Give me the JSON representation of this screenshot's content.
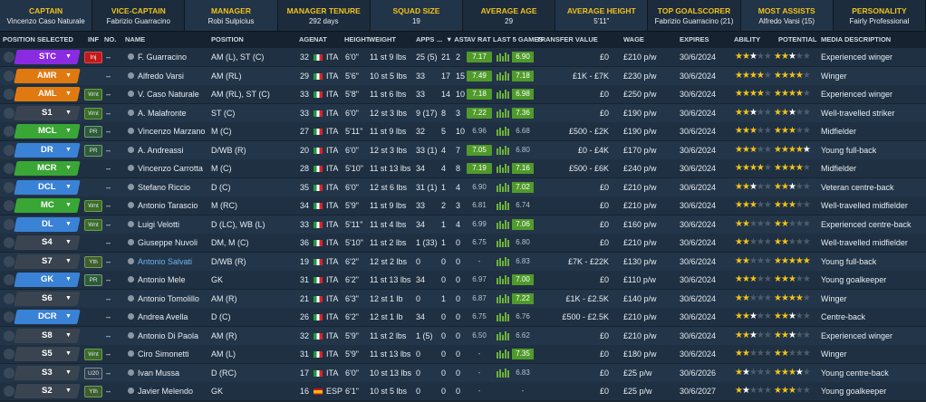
{
  "summary": [
    {
      "label": "CAPTAIN",
      "value": "Vincenzo Caso Naturale"
    },
    {
      "label": "VICE-CAPTAIN",
      "value": "Fabrizio Guarracino"
    },
    {
      "label": "MANAGER",
      "value": "Robi Sulpicius"
    },
    {
      "label": "MANAGER TENURE",
      "value": "292 days"
    },
    {
      "label": "SQUAD SIZE",
      "value": "19"
    },
    {
      "label": "AVERAGE AGE",
      "value": "29"
    },
    {
      "label": "AVERAGE HEIGHT",
      "value": "5'11\""
    },
    {
      "label": "TOP GOALSCORER",
      "value": "Fabrizio Guarracino (21)"
    },
    {
      "label": "MOST ASSISTS",
      "value": "Alfredo Varsi (15)"
    },
    {
      "label": "PERSONALITY",
      "value": "Fairly Professional"
    }
  ],
  "columns": {
    "position_selected": "POSITION SELECTED",
    "inf": "INF",
    "no": "NO.",
    "name": "NAME",
    "position": "POSITION",
    "age": "AGE",
    "nat": "NAT",
    "height": "HEIGHT",
    "weight": "WEIGHT",
    "apps": "APPS",
    "gls": "...",
    "ast": "▼ AST",
    "av_rat": "AV RAT",
    "last5": "LAST 5 GAMES",
    "transfer": "TRANSFER VALUE",
    "wage": "WAGE",
    "expires": "EXPIRES",
    "ability": "ABILITY",
    "potential": "POTENTIAL",
    "media": "MEDIA DESCRIPTION"
  },
  "colors": {
    "purple": "#8a2be2",
    "orange": "#e07a10",
    "green": "#3aa635",
    "blue": "#3a82d6",
    "dark": "#3a4450"
  },
  "players": [
    {
      "slot": "STC",
      "slot_color": "purple",
      "inf": "Inj",
      "no": "–",
      "name": "F. Guarracino",
      "position": "AM (L), ST (C)",
      "age": "32",
      "nat": "ITA",
      "height": "6'0\"",
      "weight": "11 st 9 lbs",
      "apps": "25 (5)",
      "gls": "21",
      "ast": "2",
      "avr": "7.17",
      "avr_hl": true,
      "l5": "6.90",
      "l5_hl": true,
      "transfer": "£0",
      "wage": "£210 p/w",
      "expires": "30/6/2024",
      "ability": 2.5,
      "potential": 2.5,
      "media": "Experienced winger"
    },
    {
      "slot": "AMR",
      "slot_color": "orange",
      "inf": "",
      "no": "–",
      "name": "Alfredo Varsi",
      "position": "AM (RL)",
      "age": "29",
      "nat": "ITA",
      "height": "5'6\"",
      "weight": "10 st 5 lbs",
      "apps": "33",
      "gls": "17",
      "ast": "15",
      "avr": "7.49",
      "avr_hl": true,
      "l5": "7.18",
      "l5_hl": true,
      "transfer": "£1K - £7K",
      "wage": "£230 p/w",
      "expires": "30/6/2024",
      "ability": 4,
      "potential": 4,
      "media": "Winger"
    },
    {
      "slot": "AML",
      "slot_color": "orange",
      "inf": "Wnt",
      "no": "–",
      "name": "V. Caso Naturale",
      "position": "AM (RL), ST (C)",
      "age": "33",
      "nat": "ITA",
      "height": "5'8\"",
      "weight": "11 st 6 lbs",
      "apps": "33",
      "gls": "14",
      "ast": "10",
      "avr": "7.18",
      "avr_hl": true,
      "l5": "6.98",
      "l5_hl": true,
      "transfer": "£0",
      "wage": "£250 p/w",
      "expires": "30/6/2024",
      "ability": 4,
      "potential": 4,
      "media": "Experienced winger"
    },
    {
      "slot": "S1",
      "slot_color": "dark",
      "inf": "Wnt",
      "no": "–",
      "name": "A. Malafronte",
      "position": "ST (C)",
      "age": "33",
      "nat": "ITA",
      "height": "6'0\"",
      "weight": "12 st 3 lbs",
      "apps": "9 (17)",
      "gls": "8",
      "ast": "3",
      "avr": "7.22",
      "avr_hl": true,
      "l5": "7.36",
      "l5_hl": true,
      "transfer": "£0",
      "wage": "£190 p/w",
      "expires": "30/6/2024",
      "ability": 2.5,
      "potential": 2.5,
      "media": "Well-travelled striker"
    },
    {
      "slot": "MCL",
      "slot_color": "green",
      "inf": "PR",
      "no": "–",
      "name": "Vincenzo Marzano",
      "position": "M (C)",
      "age": "27",
      "nat": "ITA",
      "height": "5'11\"",
      "weight": "11 st 9 lbs",
      "apps": "32",
      "gls": "5",
      "ast": "10",
      "avr": "6.96",
      "avr_hl": false,
      "l5": "6.68",
      "l5_hl": false,
      "transfer": "£500 - £2K",
      "wage": "£190 p/w",
      "expires": "30/6/2024",
      "ability": 3,
      "potential": 3,
      "media": "Midfielder"
    },
    {
      "slot": "DR",
      "slot_color": "blue",
      "inf": "PR",
      "no": "–",
      "name": "A. Andreassi",
      "position": "D/WB (R)",
      "age": "20",
      "nat": "ITA",
      "height": "6'0\"",
      "weight": "12 st 3 lbs",
      "apps": "33 (1)",
      "gls": "4",
      "ast": "7",
      "avr": "7.05",
      "avr_hl": true,
      "l5": "6.80",
      "l5_hl": false,
      "transfer": "£0 - £4K",
      "wage": "£170 p/w",
      "expires": "30/6/2024",
      "ability": 3,
      "potential": 4.5,
      "media": "Young full-back"
    },
    {
      "slot": "MCR",
      "slot_color": "green",
      "inf": "",
      "no": "–",
      "name": "Vincenzo Carrotta",
      "position": "M (C)",
      "age": "28",
      "nat": "ITA",
      "height": "5'10\"",
      "weight": "11 st 13 lbs",
      "apps": "34",
      "gls": "4",
      "ast": "8",
      "avr": "7.19",
      "avr_hl": true,
      "l5": "7.16",
      "l5_hl": true,
      "transfer": "£500 - £6K",
      "wage": "£240 p/w",
      "expires": "30/6/2024",
      "ability": 4,
      "potential": 4,
      "media": "Midfielder"
    },
    {
      "slot": "DCL",
      "slot_color": "blue",
      "inf": "",
      "no": "–",
      "name": "Stefano Riccio",
      "position": "D (C)",
      "age": "35",
      "nat": "ITA",
      "height": "6'0\"",
      "weight": "12 st 6 lbs",
      "apps": "31 (1)",
      "gls": "1",
      "ast": "4",
      "avr": "6.90",
      "avr_hl": false,
      "l5": "7.02",
      "l5_hl": true,
      "transfer": "£0",
      "wage": "£210 p/w",
      "expires": "30/6/2024",
      "ability": 2.5,
      "potential": 2.5,
      "media": "Veteran centre-back"
    },
    {
      "slot": "MC",
      "slot_color": "green",
      "inf": "Wnt",
      "no": "–",
      "name": "Antonio Tarascio",
      "position": "M (RC)",
      "age": "34",
      "nat": "ITA",
      "height": "5'9\"",
      "weight": "11 st 9 lbs",
      "apps": "33",
      "gls": "2",
      "ast": "3",
      "avr": "6.81",
      "avr_hl": false,
      "l5": "6.74",
      "l5_hl": false,
      "transfer": "£0",
      "wage": "£210 p/w",
      "expires": "30/6/2024",
      "ability": 3,
      "potential": 3,
      "media": "Well-travelled midfielder"
    },
    {
      "slot": "DL",
      "slot_color": "blue",
      "inf": "Wnt",
      "no": "–",
      "name": "Luigi Velotti",
      "position": "D (LC), WB (L)",
      "age": "33",
      "nat": "ITA",
      "height": "5'11\"",
      "weight": "11 st 4 lbs",
      "apps": "34",
      "gls": "1",
      "ast": "4",
      "avr": "6.99",
      "avr_hl": false,
      "l5": "7.06",
      "l5_hl": true,
      "transfer": "£0",
      "wage": "£160 p/w",
      "expires": "30/6/2024",
      "ability": 2,
      "potential": 2,
      "media": "Experienced centre-back"
    },
    {
      "slot": "S4",
      "slot_color": "dark",
      "inf": "",
      "no": "–",
      "name": "Giuseppe Nuvoli",
      "position": "DM, M (C)",
      "age": "36",
      "nat": "ITA",
      "height": "5'10\"",
      "weight": "11 st 2 lbs",
      "apps": "1 (33)",
      "gls": "1",
      "ast": "0",
      "avr": "6.75",
      "avr_hl": false,
      "l5": "6.80",
      "l5_hl": false,
      "transfer": "£0",
      "wage": "£210 p/w",
      "expires": "30/6/2024",
      "ability": 2,
      "potential": 2,
      "media": "Well-travelled midfielder"
    },
    {
      "slot": "S7",
      "slot_color": "dark",
      "inf": "Yth",
      "no": "–",
      "name": "Antonio Salvati",
      "position": "D/WB (R)",
      "age": "19",
      "nat": "ITA",
      "height": "6'2\"",
      "weight": "12 st 2 lbs",
      "apps": "0",
      "gls": "0",
      "ast": "0",
      "avr": "-",
      "avr_hl": false,
      "l5": "6.83",
      "l5_hl": false,
      "transfer": "£7K - £22K",
      "wage": "£130 p/w",
      "expires": "30/6/2024",
      "ability": 2,
      "potential": 5,
      "media": "Young full-back",
      "selected": true
    },
    {
      "slot": "GK",
      "slot_color": "blue",
      "inf": "PR",
      "no": "–",
      "name": "Antonio Mele",
      "position": "GK",
      "age": "31",
      "nat": "ITA",
      "height": "6'2\"",
      "weight": "11 st 13 lbs",
      "apps": "34",
      "gls": "0",
      "ast": "0",
      "avr": "6.97",
      "avr_hl": false,
      "l5": "7.00",
      "l5_hl": true,
      "transfer": "£0",
      "wage": "£110 p/w",
      "expires": "30/6/2024",
      "ability": 3,
      "potential": 3,
      "media": "Young goalkeeper"
    },
    {
      "slot": "S6",
      "slot_color": "dark",
      "inf": "",
      "no": "–",
      "name": "Antonio Tomolillo",
      "position": "AM (R)",
      "age": "21",
      "nat": "ITA",
      "height": "6'3\"",
      "weight": "12 st 1 lb",
      "apps": "0",
      "gls": "1",
      "ast": "0",
      "avr": "6.87",
      "avr_hl": false,
      "l5": "7.22",
      "l5_hl": true,
      "transfer": "£1K - £2.5K",
      "wage": "£140 p/w",
      "expires": "30/6/2024",
      "ability": 2,
      "potential": 4,
      "media": "Winger"
    },
    {
      "slot": "DCR",
      "slot_color": "blue",
      "inf": "",
      "no": "–",
      "name": "Andrea Avella",
      "position": "D (C)",
      "age": "26",
      "nat": "ITA",
      "height": "6'2\"",
      "weight": "12 st 1 lb",
      "apps": "34",
      "gls": "0",
      "ast": "0",
      "avr": "6.75",
      "avr_hl": false,
      "l5": "6.76",
      "l5_hl": false,
      "transfer": "£500 - £2.5K",
      "wage": "£210 p/w",
      "expires": "30/6/2024",
      "ability": 2.5,
      "potential": 2.5,
      "media": "Centre-back"
    },
    {
      "slot": "S8",
      "slot_color": "dark",
      "inf": "",
      "no": "–",
      "name": "Antonio Di Paola",
      "position": "AM (R)",
      "age": "32",
      "nat": "ITA",
      "height": "5'9\"",
      "weight": "11 st 2 lbs",
      "apps": "1 (5)",
      "gls": "0",
      "ast": "0",
      "avr": "6.50",
      "avr_hl": false,
      "l5": "6.62",
      "l5_hl": false,
      "transfer": "£0",
      "wage": "£210 p/w",
      "expires": "30/6/2024",
      "ability": 2.5,
      "potential": 2.5,
      "media": "Experienced winger"
    },
    {
      "slot": "S5",
      "slot_color": "dark",
      "inf": "Wnt",
      "no": "–",
      "name": "Ciro Simonetti",
      "position": "AM (L)",
      "age": "31",
      "nat": "ITA",
      "height": "5'9\"",
      "weight": "11 st 13 lbs",
      "apps": "0",
      "gls": "0",
      "ast": "0",
      "avr": "-",
      "avr_hl": false,
      "l5": "7.35",
      "l5_hl": true,
      "transfer": "£0",
      "wage": "£180 p/w",
      "expires": "30/6/2024",
      "ability": 2,
      "potential": 2,
      "media": "Winger"
    },
    {
      "slot": "S3",
      "slot_color": "dark",
      "inf": "U20",
      "no": "–",
      "name": "Ivan Mussa",
      "position": "D (RC)",
      "age": "17",
      "nat": "ITA",
      "height": "6'0\"",
      "weight": "10 st 13 lbs",
      "apps": "0",
      "gls": "0",
      "ast": "0",
      "avr": "-",
      "avr_hl": false,
      "l5": "6.83",
      "l5_hl": false,
      "transfer": "£0",
      "wage": "£25 p/w",
      "expires": "30/6/2026",
      "ability": 1.5,
      "potential": 3.5,
      "media": "Young centre-back"
    },
    {
      "slot": "S2",
      "slot_color": "dark",
      "inf": "Yth",
      "no": "–",
      "name": "Javier Melendo",
      "position": "GK",
      "age": "16",
      "nat": "ESP",
      "height": "6'1\"",
      "weight": "10 st 5 lbs",
      "apps": "0",
      "gls": "0",
      "ast": "0",
      "avr": "-",
      "avr_hl": false,
      "l5": "-",
      "l5_hl": false,
      "transfer": "£0",
      "wage": "£25 p/w",
      "expires": "30/6/2027",
      "ability": 1.5,
      "potential": 3,
      "media": "Young goalkeeper"
    }
  ]
}
